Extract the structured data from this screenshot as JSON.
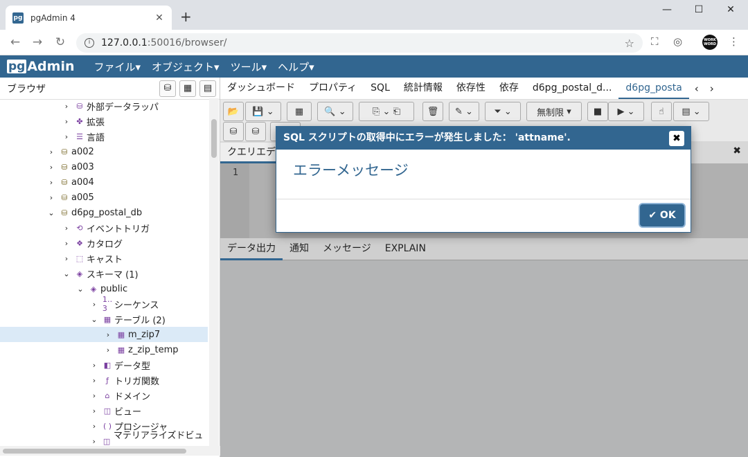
{
  "browser": {
    "tab_title": "pgAdmin 4",
    "url_host": "127.0.0.1",
    "url_path": ":50016/browser/",
    "new_tab": "+",
    "close": "✕",
    "minimize": "—",
    "maximize": "☐",
    "window_close": "✕",
    "avatar_text": "WORK WORD"
  },
  "pgadmin": {
    "logo_pg": "pg",
    "logo_admin": "Admin",
    "menus": [
      "ファイル▾",
      "オブジェクト▾",
      "ツール▾",
      "ヘルプ▾"
    ]
  },
  "browser_panel": {
    "title": "ブラウザ",
    "tree": [
      {
        "label": "外部データラッパ",
        "chev": "›",
        "icon": "fdw-icon"
      },
      {
        "label": "拡張",
        "chev": "›",
        "icon": "extension-icon"
      },
      {
        "label": "言語",
        "chev": "›",
        "icon": "language-icon"
      },
      {
        "label": "a002",
        "chev": "›",
        "icon": "database-icon"
      },
      {
        "label": "a003",
        "chev": "›",
        "icon": "database-icon"
      },
      {
        "label": "a004",
        "chev": "›",
        "icon": "database-icon"
      },
      {
        "label": "a005",
        "chev": "›",
        "icon": "database-icon"
      },
      {
        "label": "d6pg_postal_db",
        "chev": "⌄",
        "icon": "database-icon"
      },
      {
        "label": "イベントトリガ",
        "chev": "›",
        "icon": "event-trigger-icon"
      },
      {
        "label": "カタログ",
        "chev": "›",
        "icon": "catalog-icon"
      },
      {
        "label": "キャスト",
        "chev": "›",
        "icon": "cast-icon"
      },
      {
        "label": "スキーマ (1)",
        "chev": "⌄",
        "icon": "schema-icon"
      },
      {
        "label": "public",
        "chev": "⌄",
        "icon": "schema-icon"
      },
      {
        "label": "シーケンス",
        "chev": "›",
        "icon": "sequence-icon"
      },
      {
        "label": "テーブル (2)",
        "chev": "⌄",
        "icon": "table-icon"
      },
      {
        "label": "m_zip7",
        "chev": "›",
        "icon": "table-icon"
      },
      {
        "label": "z_zip_temp",
        "chev": "›",
        "icon": "table-icon"
      },
      {
        "label": "データ型",
        "chev": "›",
        "icon": "type-icon"
      },
      {
        "label": "トリガ関数",
        "chev": "›",
        "icon": "trigger-function-icon"
      },
      {
        "label": "ドメイン",
        "chev": "›",
        "icon": "domain-icon"
      },
      {
        "label": "ビュー",
        "chev": "›",
        "icon": "view-icon"
      },
      {
        "label": "プロシージャ",
        "chev": "›",
        "icon": "procedure-icon"
      },
      {
        "label": "マテリアライズドビュー",
        "chev": "›",
        "icon": "mview-icon"
      }
    ]
  },
  "main_tabs": [
    "ダッシュボード",
    "プロパティ",
    "SQL",
    "統計情報",
    "依存性",
    "依存",
    "d6pg_postal_d...",
    "d6pg_posta"
  ],
  "query_tool": {
    "limit_label": "無制限",
    "editor_tab": "クエリエデ",
    "line_number": "1",
    "output_tabs": [
      "データ出力",
      "通知",
      "メッセージ",
      "EXPLAIN"
    ]
  },
  "dialog": {
    "title": "SQL スクリプトの取得中にエラーが発生しました： 'attname'.",
    "close": "✖",
    "message": "エラーメッセージ",
    "ok_label": "OK",
    "ok_check": "✔"
  },
  "colors": {
    "brand": "#326690",
    "selected_row": "#dbeaf7"
  }
}
